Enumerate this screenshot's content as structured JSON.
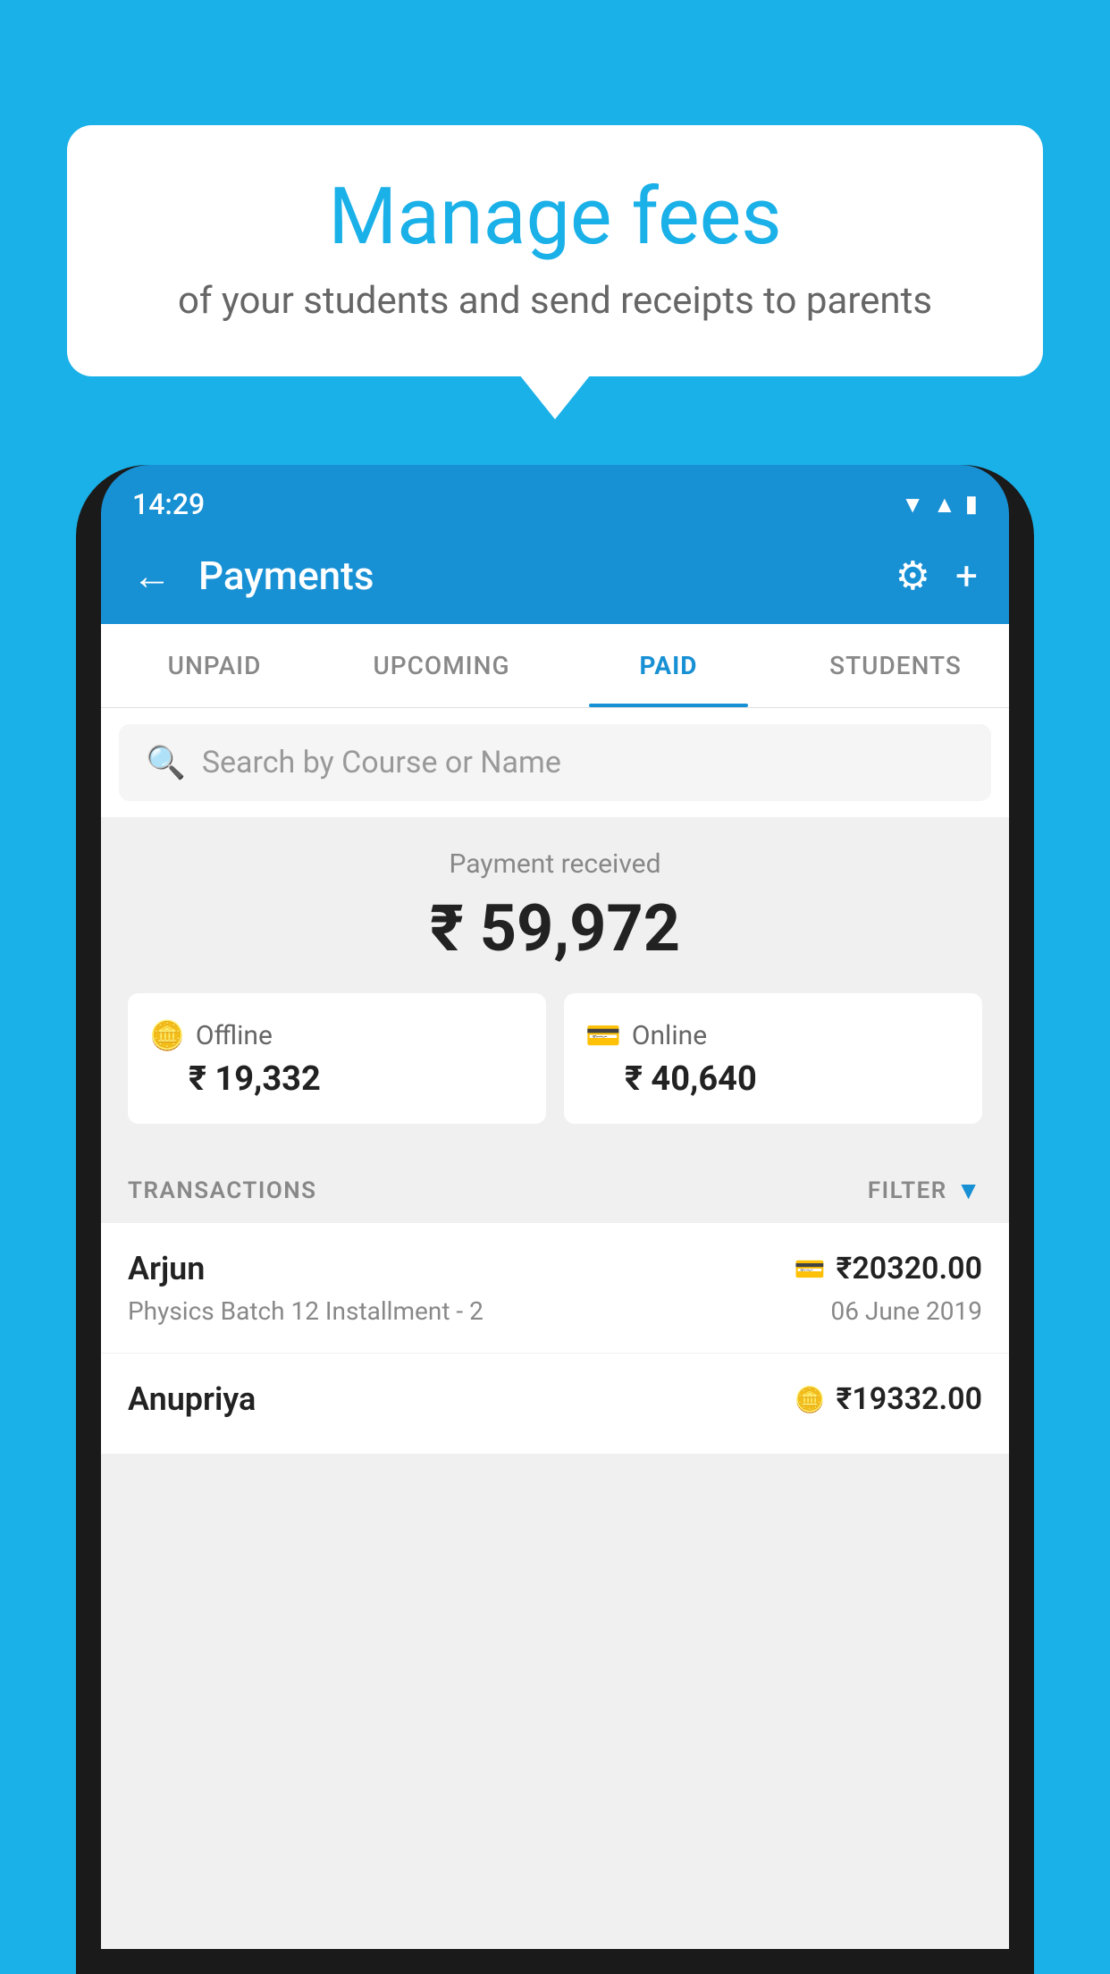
{
  "background_color": "#1ab0e8",
  "bubble": {
    "title": "Manage fees",
    "subtitle": "of your students and send receipts to parents"
  },
  "status_bar": {
    "time": "14:29",
    "icons": [
      "wifi",
      "signal",
      "battery"
    ]
  },
  "app_bar": {
    "title": "Payments",
    "back_label": "←",
    "settings_label": "⚙",
    "add_label": "+"
  },
  "tabs": [
    {
      "label": "UNPAID",
      "active": false
    },
    {
      "label": "UPCOMING",
      "active": false
    },
    {
      "label": "PAID",
      "active": true
    },
    {
      "label": "STUDENTS",
      "active": false
    }
  ],
  "search": {
    "placeholder": "Search by Course or Name"
  },
  "payment_summary": {
    "label": "Payment received",
    "amount": "₹ 59,972",
    "offline": {
      "type": "Offline",
      "amount": "₹ 19,332"
    },
    "online": {
      "type": "Online",
      "amount": "₹ 40,640"
    }
  },
  "transactions_section": {
    "label": "TRANSACTIONS",
    "filter_label": "FILTER"
  },
  "transactions": [
    {
      "name": "Arjun",
      "course": "Physics Batch 12 Installment - 2",
      "amount": "₹20320.00",
      "date": "06 June 2019",
      "pay_type": "card"
    },
    {
      "name": "Anupriya",
      "course": "",
      "amount": "₹19332.00",
      "date": "",
      "pay_type": "cash"
    }
  ]
}
